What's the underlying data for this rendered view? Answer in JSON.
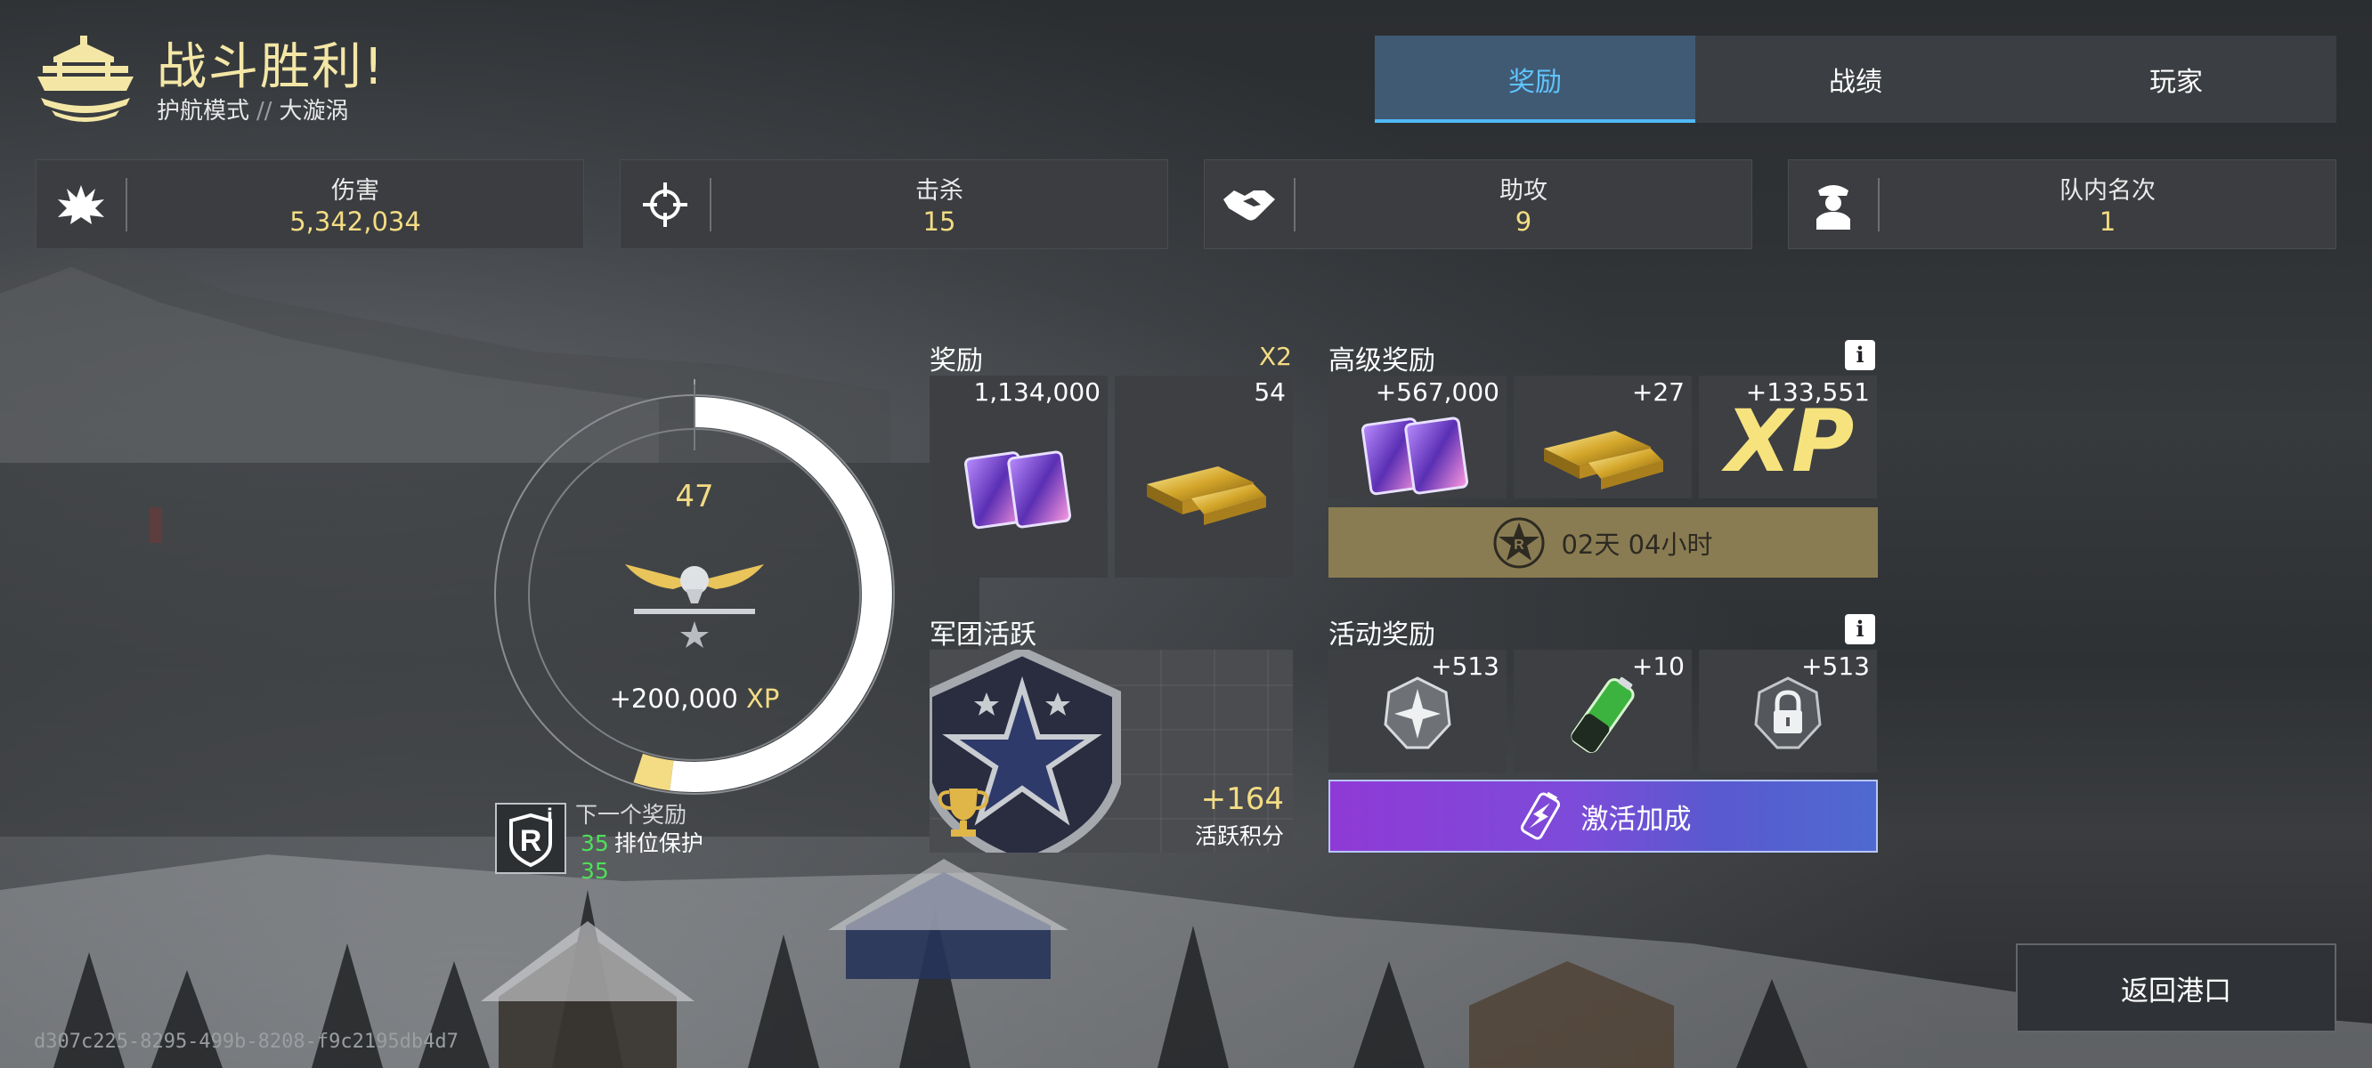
{
  "header": {
    "title": "战斗胜利!",
    "mode": "护航模式",
    "separator": "//",
    "map": "大漩涡",
    "emblem_icon": "warship-emblem-icon"
  },
  "tabs": [
    {
      "label": "奖励",
      "active": true
    },
    {
      "label": "战绩",
      "active": false
    },
    {
      "label": "玩家",
      "active": false
    }
  ],
  "stats": [
    {
      "label": "伤害",
      "value": "5,342,034",
      "icon": "explosion-icon"
    },
    {
      "label": "击杀",
      "value": "15",
      "icon": "crosshair-icon"
    },
    {
      "label": "助攻",
      "value": "9",
      "icon": "handshake-icon"
    },
    {
      "label": "队内名次",
      "value": "1",
      "icon": "captain-icon"
    }
  ],
  "progress": {
    "level": "47",
    "xp_gain": "+200,000",
    "xp_unit": "XP",
    "ring_fill_fraction": 0.55,
    "next_reward_label": "下一个奖励",
    "next_reward_count": "35",
    "next_reward_name": "排位保护",
    "next_reward_count_2": "35",
    "rank_icon": "eagle-rank-icon"
  },
  "rewards": {
    "title": "奖励",
    "multiplier": "X2",
    "items": [
      {
        "amount": "1,134,000",
        "icon": "credit-cards-icon"
      },
      {
        "amount": "54",
        "icon": "gold-bars-icon"
      }
    ]
  },
  "premium_rewards": {
    "title": "高级奖励",
    "items": [
      {
        "amount": "+567,000",
        "icon": "credit-cards-icon"
      },
      {
        "amount": "+27",
        "icon": "gold-bars-icon"
      },
      {
        "amount": "+133,551",
        "icon": "xp-icon",
        "text": "XP"
      }
    ],
    "timer": "02天 04小时"
  },
  "legion": {
    "title": "军团活跃",
    "points": "+164",
    "points_label": "活跃积分"
  },
  "event_rewards": {
    "title": "活动奖励",
    "items": [
      {
        "amount": "+513",
        "icon": "compass-star-icon"
      },
      {
        "amount": "+10",
        "icon": "battery-icon"
      },
      {
        "amount": "+513",
        "icon": "lock-icon"
      }
    ],
    "activate_label": "激活加成"
  },
  "return_button": "返回港口",
  "match_id": "d307c225-8295-499b-8208-f9c2195db4d7",
  "colors": {
    "accent_gold": "#f3dc84",
    "tab_active": "#5fc4ff",
    "green": "#4fe05a"
  }
}
